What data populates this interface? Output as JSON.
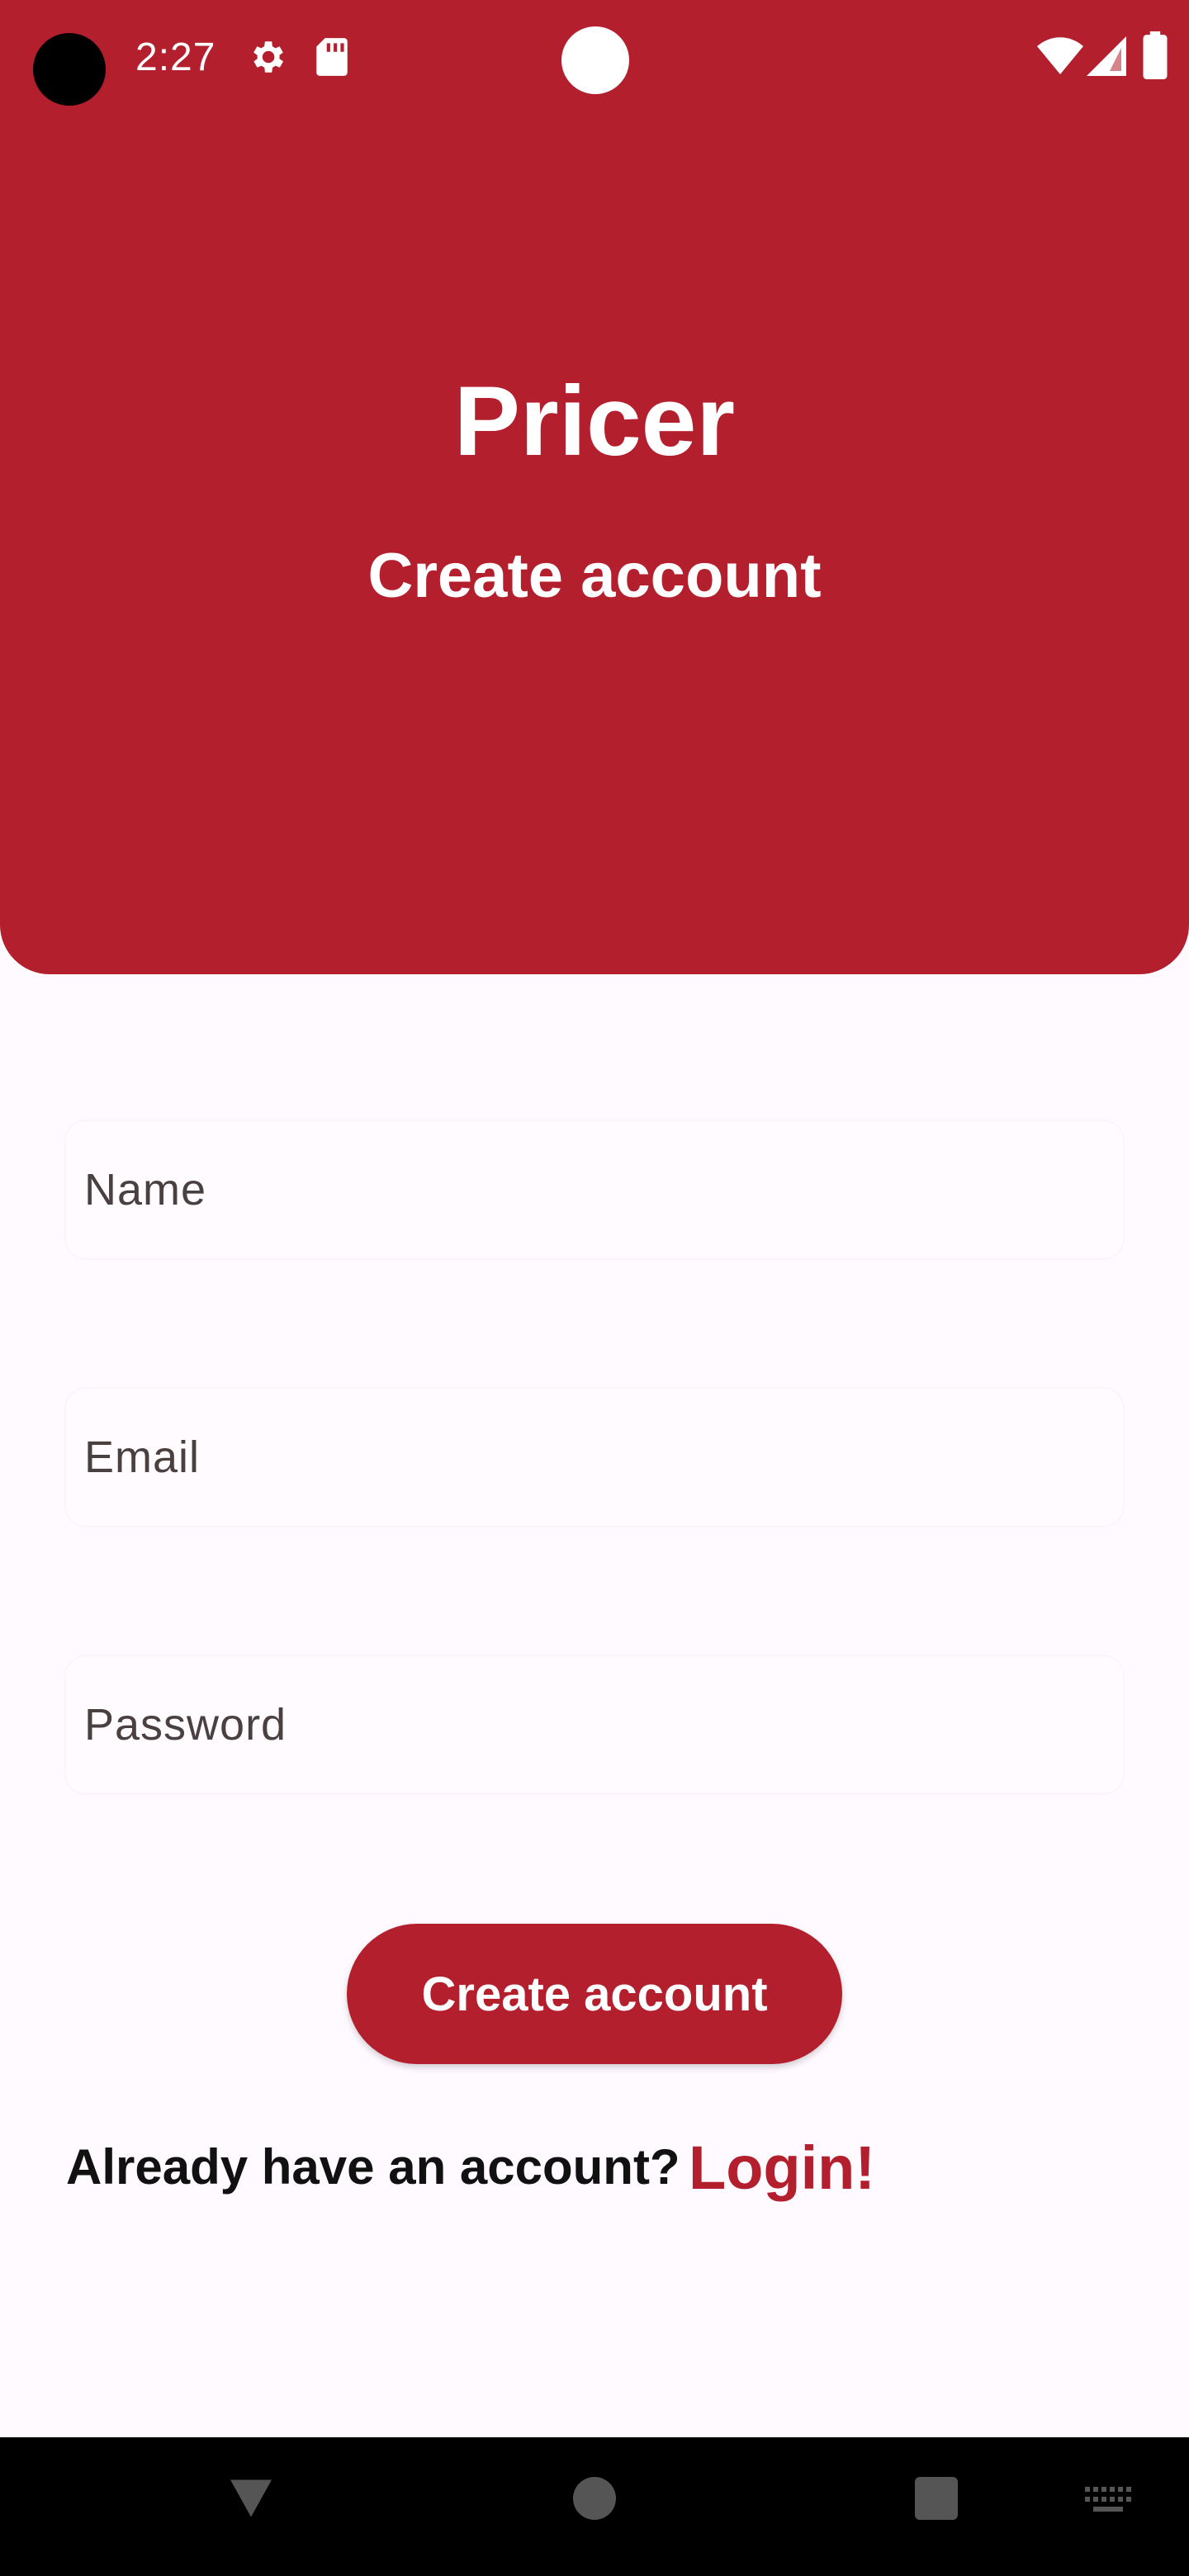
{
  "status_bar": {
    "time": "2:27",
    "icons": [
      "camera-hole",
      "gear-icon",
      "sd-card-icon",
      "wifi-icon",
      "signal-icon",
      "battery-icon"
    ]
  },
  "header": {
    "app_name": "Pricer",
    "subtitle": "Create account",
    "color": "#b31f2c"
  },
  "form": {
    "name_placeholder": "Name",
    "email_placeholder": "Email",
    "password_placeholder": "Password",
    "submit_label": "Create account"
  },
  "footer": {
    "prompt": "Already have an account?",
    "login_label": "Login!"
  },
  "nav_bar": {
    "icons": [
      "back-icon",
      "home-icon",
      "recents-icon",
      "keyboard-icon"
    ]
  }
}
